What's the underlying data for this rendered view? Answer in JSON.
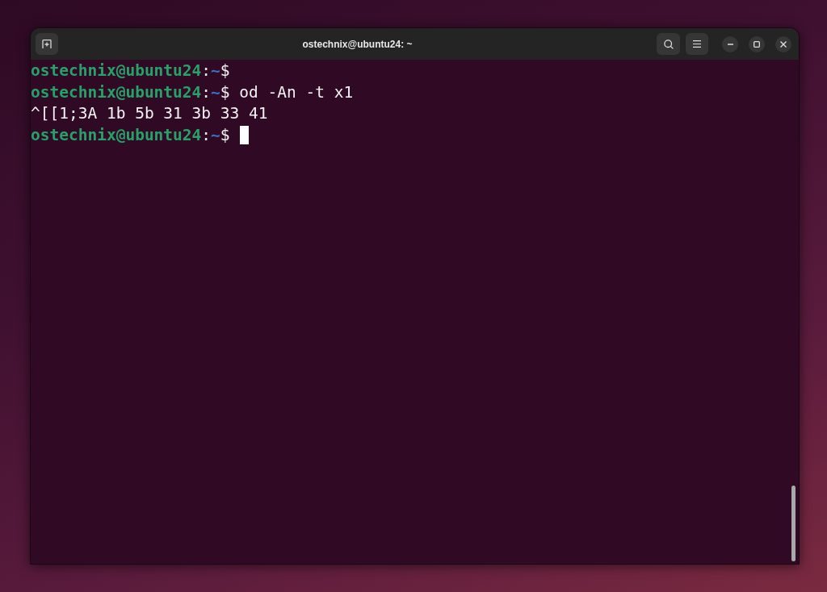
{
  "window": {
    "title": "ostechnix@ubuntu24: ~"
  },
  "terminal": {
    "lines": [
      {
        "kind": "prompt",
        "user": "ostechnix@ubuntu24",
        "separator": ":",
        "path": "~",
        "symbol": "$",
        "cursor": false
      },
      {
        "kind": "prompt",
        "user": "ostechnix@ubuntu24",
        "separator": ":",
        "path": "~",
        "symbol": "$",
        "command": "od -An -t x1",
        "cursor": false
      },
      {
        "kind": "output",
        "text": "^[[1;3A 1b 5b 31 3b 33 41",
        "cursor": false
      },
      {
        "kind": "prompt",
        "user": "ostechnix@ubuntu24",
        "separator": ":",
        "path": "~",
        "symbol": "$",
        "cursor": true
      }
    ]
  }
}
